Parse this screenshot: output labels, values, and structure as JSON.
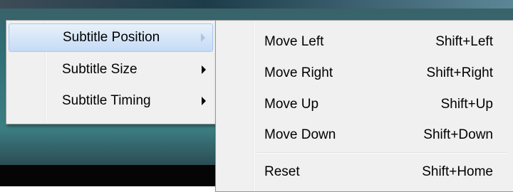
{
  "menu": {
    "items": [
      {
        "label": "Subtitle Position",
        "has_submenu": true,
        "highlighted": true
      },
      {
        "label": "Subtitle Size",
        "has_submenu": true,
        "highlighted": false
      },
      {
        "label": "Subtitle Timing",
        "has_submenu": true,
        "highlighted": false
      }
    ]
  },
  "submenu": {
    "items": [
      {
        "label": "Move Left",
        "shortcut": "Shift+Left"
      },
      {
        "label": "Move Right",
        "shortcut": "Shift+Right"
      },
      {
        "label": "Move Up",
        "shortcut": "Shift+Up"
      },
      {
        "label": "Move Down",
        "shortcut": "Shift+Down"
      },
      {
        "label": "Reset",
        "shortcut": "Shift+Home"
      }
    ]
  },
  "colors": {
    "highlight": "#c5dbf5",
    "menu_background": "#f0f0f0"
  },
  "icons": {
    "submenu_indicator": "chevron-right-icon"
  }
}
